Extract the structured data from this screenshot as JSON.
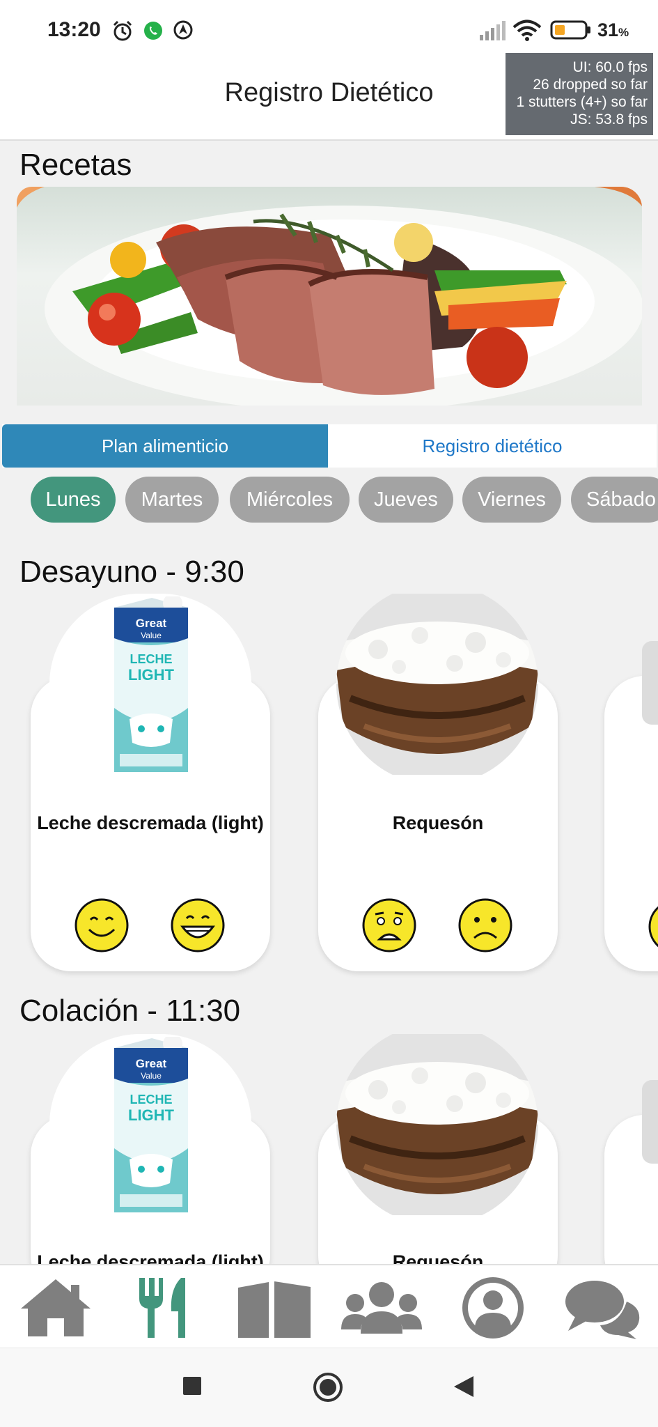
{
  "status_bar": {
    "time": "13:20",
    "battery_percent": "31",
    "battery_unit": "%",
    "icons": [
      "alarm-clock-icon",
      "whatsapp-icon",
      "location-icon",
      "signal-icon",
      "wifi-icon",
      "battery-icon"
    ]
  },
  "header": {
    "title": "Registro Dietético"
  },
  "perf_overlay": {
    "line1": "UI: 60.0 fps",
    "line2": "26 dropped so far",
    "line3": "1 stutters (4+) so far",
    "line4": "JS: 53.8 fps"
  },
  "recipes": {
    "title": "Recetas",
    "active_slide": 1
  },
  "segmented": {
    "plan_label": "Plan alimenticio",
    "registro_label": "Registro dietético",
    "selected": "Plan alimenticio"
  },
  "days": {
    "items": [
      "Lunes",
      "Martes",
      "Miércoles",
      "Jueves",
      "Viernes",
      "Sábado"
    ],
    "selected": "Lunes"
  },
  "meals": [
    {
      "title": "Desayuno - 9:30",
      "foods": [
        {
          "name": "Leche descremada (light)",
          "image": "milk-carton-image",
          "reactions": [
            "smile-icon",
            "grin-icon"
          ]
        },
        {
          "name": "Requesón",
          "image": "cottage-cheese-bowl-image",
          "reactions": [
            "worried-icon",
            "frown-icon"
          ]
        }
      ]
    },
    {
      "title": "Colación - 11:30",
      "foods": [
        {
          "name": "Leche descremada (light)",
          "image": "milk-carton-image"
        },
        {
          "name": "Requesón",
          "image": "cottage-cheese-bowl-image"
        }
      ]
    }
  ],
  "product_label": {
    "brand_line1": "Great",
    "brand_line2": "Value",
    "product_line1": "LECHE",
    "product_line2": "LIGHT"
  },
  "bottom_nav": {
    "items": [
      "home-icon",
      "utensils-icon",
      "book-icon",
      "community-icon",
      "profile-icon",
      "chat-icon"
    ],
    "active": "utensils-icon",
    "active_color": "#43967d",
    "inactive_color": "#7f7f7f"
  },
  "colors": {
    "accent_blue": "#2f88b8",
    "accent_green": "#43967d",
    "chip_grey": "#a3a3a3",
    "face_yellow": "#f7e62a"
  }
}
